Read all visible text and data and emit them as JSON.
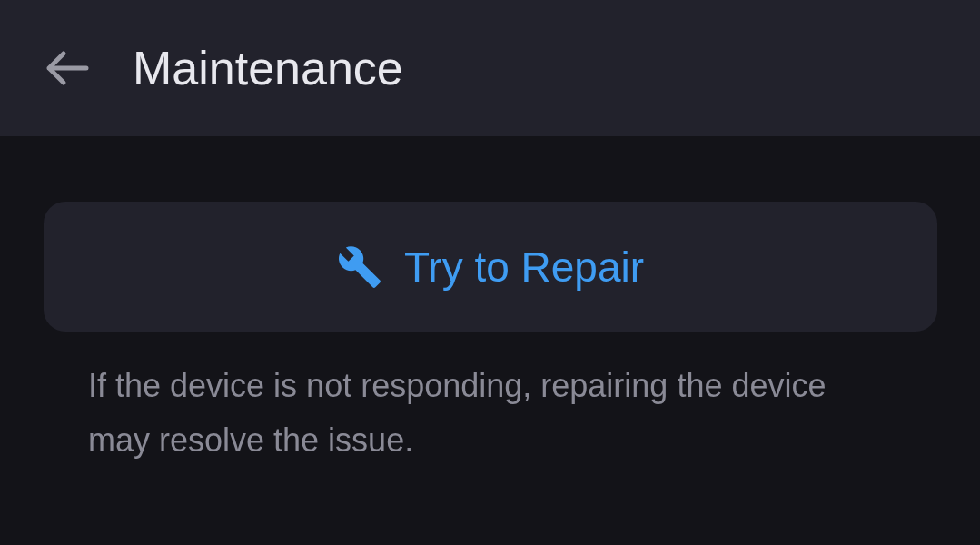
{
  "header": {
    "title": "Maintenance"
  },
  "repair_button": {
    "label": "Try to Repair"
  },
  "description": "If the device is not responding, repairing the device may resolve the issue."
}
